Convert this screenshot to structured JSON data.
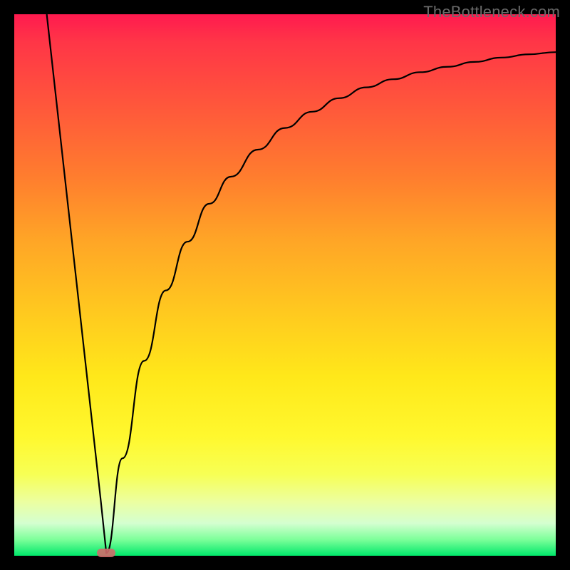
{
  "watermark": "TheBottleneck.com",
  "colors": {
    "frame": "#000000",
    "marker": "#d06a6a",
    "curve": "#000000",
    "gradient_top": "#ff1a4f",
    "gradient_bottom": "#00e86a"
  },
  "chart_data": {
    "type": "line",
    "title": "",
    "xlabel": "",
    "ylabel": "",
    "xlim": [
      0,
      100
    ],
    "ylim": [
      0,
      100
    ],
    "grid": false,
    "legend": false,
    "annotations": [
      {
        "name": "min-marker",
        "x": 17,
        "y": 0.5
      }
    ],
    "series": [
      {
        "name": "left-branch",
        "x": [
          6,
          8,
          10,
          12,
          14,
          15,
          16,
          17
        ],
        "values": [
          100,
          82,
          64,
          46,
          28,
          19,
          10,
          0.5
        ]
      },
      {
        "name": "right-branch",
        "x": [
          17,
          20,
          24,
          28,
          32,
          36,
          40,
          45,
          50,
          55,
          60,
          65,
          70,
          75,
          80,
          85,
          90,
          95,
          100
        ],
        "values": [
          0.5,
          18,
          36,
          49,
          58,
          65,
          70,
          75,
          79,
          82,
          84.5,
          86.5,
          88,
          89.3,
          90.3,
          91.2,
          92,
          92.6,
          93
        ]
      }
    ]
  }
}
